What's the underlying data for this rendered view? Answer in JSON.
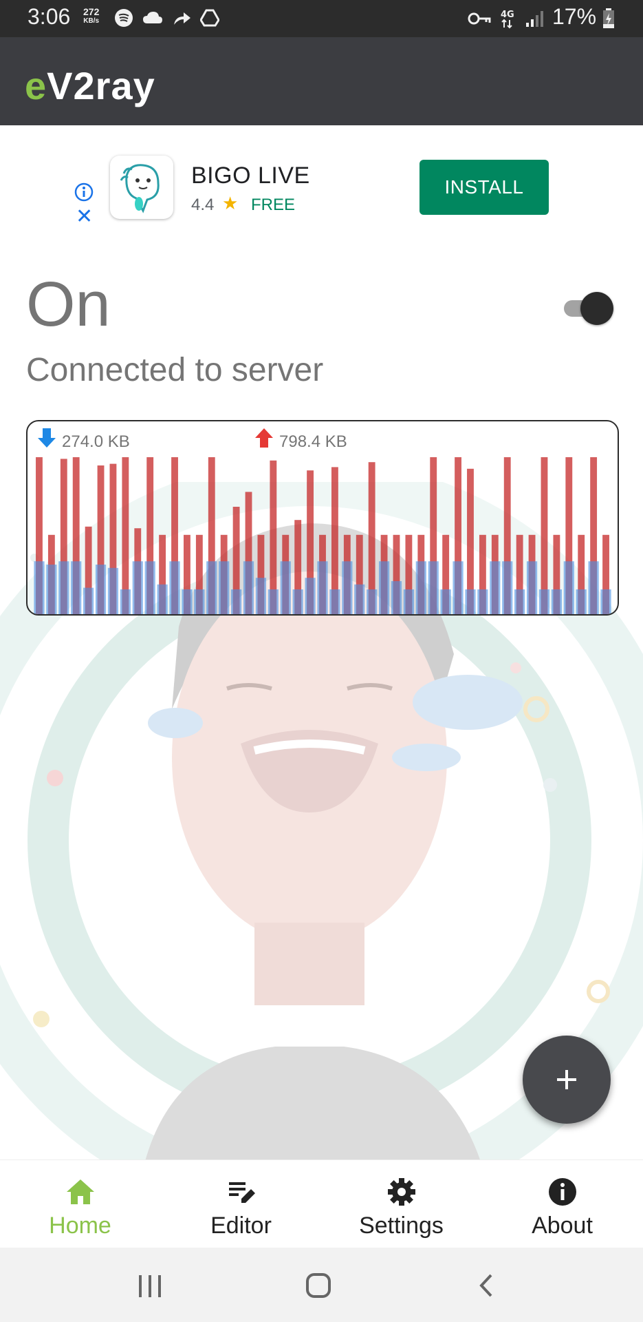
{
  "status_bar": {
    "time": "3:06",
    "speed_value": "272",
    "speed_unit": "KB/s",
    "battery": "17%",
    "network": "4G",
    "icons_left": [
      "spotify-icon",
      "cloud-icon",
      "forward-icon",
      "drive-icon"
    ],
    "icons_right": [
      "vpn-key-icon",
      "network-4g-icon",
      "signal-icon",
      "battery-charging-icon"
    ]
  },
  "app_bar": {
    "title_accent": "e",
    "title_rest": "V2ray",
    "accent_color": "#8bc34a"
  },
  "ad": {
    "app_name": "BIGO LIVE",
    "rating": "4.4",
    "price": "FREE",
    "install_label": "INSTALL",
    "install_color": "#01875f"
  },
  "connection": {
    "state": "On",
    "detail": "Connected to server",
    "toggle_on": true
  },
  "traffic": {
    "download": "274.0 KB",
    "upload": "798.4 KB",
    "download_color": "#4a90e2",
    "upload_color": "#c62828"
  },
  "chart_data": {
    "type": "bar",
    "series": [
      {
        "name": "274.0 KB",
        "values": [
          0.32,
          0.3,
          0.32,
          0.32,
          0.16,
          0.3,
          0.28,
          0.15,
          0.32,
          0.32,
          0.18,
          0.32,
          0.15,
          0.15,
          0.32,
          0.32,
          0.15,
          0.32,
          0.22,
          0.15,
          0.32,
          0.15,
          0.22,
          0.32,
          0.15,
          0.32,
          0.18,
          0.15,
          0.32,
          0.2,
          0.15,
          0.32,
          0.32,
          0.15,
          0.32,
          0.15,
          0.15,
          0.32,
          0.32,
          0.15,
          0.32,
          0.15,
          0.15,
          0.32,
          0.15,
          0.32,
          0.15
        ]
      },
      {
        "name": "798.4 KB",
        "values": [
          0.95,
          0.48,
          0.94,
          0.95,
          0.53,
          0.9,
          0.91,
          0.95,
          0.52,
          0.95,
          0.48,
          0.95,
          0.48,
          0.48,
          0.95,
          0.48,
          0.65,
          0.74,
          0.48,
          0.93,
          0.48,
          0.57,
          0.87,
          0.48,
          0.89,
          0.48,
          0.48,
          0.92,
          0.48,
          0.48,
          0.48,
          0.48,
          0.95,
          0.48,
          0.95,
          0.88,
          0.48,
          0.48,
          0.95,
          0.48,
          0.48,
          0.95,
          0.48,
          0.95,
          0.48,
          0.95,
          0.48
        ]
      }
    ]
  },
  "fab": {
    "icon": "plus-icon"
  },
  "bottom_nav": {
    "items": [
      {
        "label": "Home",
        "icon": "home-icon",
        "active": true
      },
      {
        "label": "Editor",
        "icon": "editor-icon",
        "active": false
      },
      {
        "label": "Settings",
        "icon": "settings-icon",
        "active": false
      },
      {
        "label": "About",
        "icon": "info-icon",
        "active": false
      }
    ]
  },
  "system_nav": {
    "buttons": [
      "recents-button",
      "home-button",
      "back-button"
    ]
  }
}
